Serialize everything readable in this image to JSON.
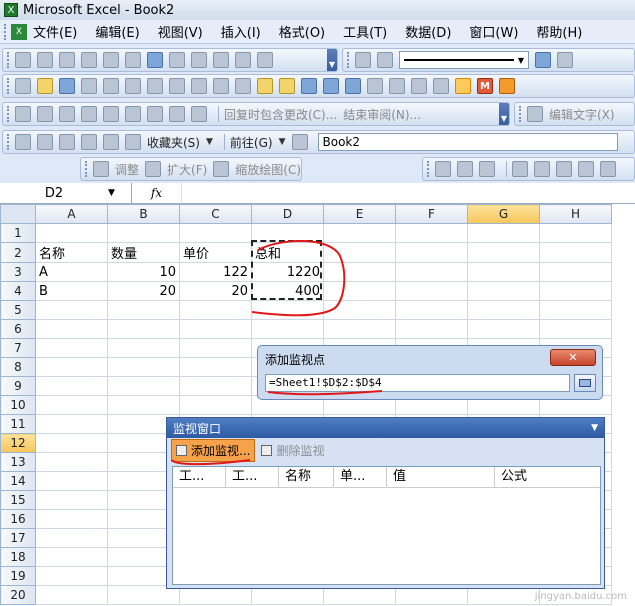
{
  "window": {
    "title": "Microsoft Excel - Book2",
    "app_icon_glyph": "X"
  },
  "menu": [
    "文件(E)",
    "编辑(E)",
    "视图(V)",
    "插入(I)",
    "格式(O)",
    "工具(T)",
    "数据(D)",
    "窗口(W)",
    "帮助(H)"
  ],
  "toolbar3": {
    "review_text": "回复时包含更改(C)...",
    "end_review": "结束审阅(N)...",
    "edit_text": "编辑文字(X)"
  },
  "toolbar4": {
    "favorites": "收藏夹(S)",
    "goto": "前往(G)",
    "doc_name": "Book2"
  },
  "toolbar5": {
    "adjust": "调整",
    "zoom_in": "扩大(F)",
    "scale_draw": "缩放绘图(C)"
  },
  "name_box": "D2",
  "fx_label": "fx",
  "columns": [
    "A",
    "B",
    "C",
    "D",
    "E",
    "F",
    "G",
    "H"
  ],
  "active_column": "G",
  "rows": [
    "1",
    "2",
    "3",
    "4",
    "5",
    "6",
    "7",
    "8",
    "9",
    "10",
    "11",
    "12",
    "13",
    "14",
    "15",
    "16",
    "17",
    "18",
    "19",
    "20"
  ],
  "active_row": "12",
  "cells": {
    "a2": "名称",
    "b2": "数量",
    "c2": "单价",
    "d2": "总和",
    "a3": "A",
    "b3": "10",
    "c3": "122",
    "d3": "1220",
    "a4": "B",
    "b4": "20",
    "c4": "20",
    "d4": "400"
  },
  "add_watch_dialog": {
    "title": "添加监视点",
    "close": "✕",
    "reference": "=Sheet1!$D$2:$D$4"
  },
  "watch_window": {
    "title": "监视窗口",
    "add": "添加监视...",
    "delete": "删除监视",
    "columns": [
      "工...",
      "工...",
      "名称",
      "单...",
      "值",
      "公式"
    ]
  },
  "watermark": "jingyan.baidu.com",
  "annotation_color": "#e01818"
}
